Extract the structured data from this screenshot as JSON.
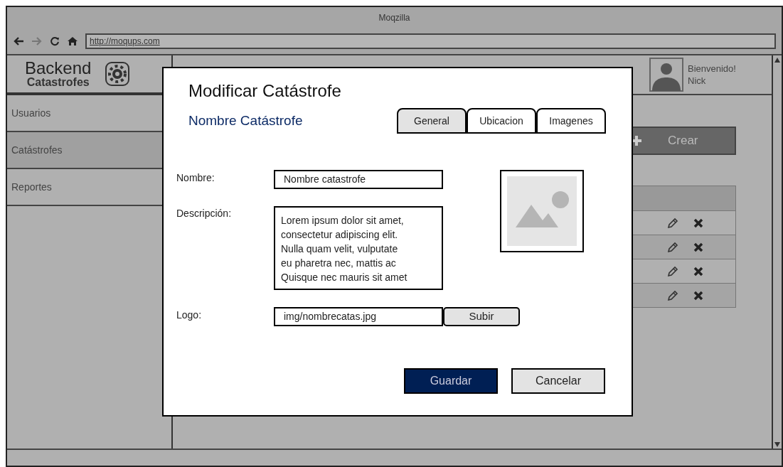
{
  "browser": {
    "title": "Moqzilla",
    "url": "http://moqups.com"
  },
  "sidebar": {
    "brand": "Backend",
    "brand_sub": "Catastrofes",
    "items": [
      {
        "label": "Usuarios",
        "selected": false
      },
      {
        "label": "Catástrofes",
        "selected": true
      },
      {
        "label": "Reportes",
        "selected": false
      }
    ]
  },
  "user": {
    "greeting": "Bienvenido!",
    "name": "Nick"
  },
  "create_button": "Crear",
  "dialog": {
    "title": "Modificar Catástrofe",
    "subtitle": "Nombre Catástrofe",
    "tabs": [
      {
        "label": "General",
        "selected": true
      },
      {
        "label": "Ubicacion",
        "selected": false
      },
      {
        "label": "Imagenes",
        "selected": false
      }
    ],
    "fields": [
      {
        "label": "Nombre:",
        "kind": "input",
        "value": "Nombre catastrofe"
      },
      {
        "label": "Descripción:",
        "kind": "textarea",
        "value": "Lorem ipsum dolor sit amet,\nconsectetur adipiscing elit.\nNulla quam velit, vulputate\neu pharetra nec, mattis ac\nQuisque nec mauris sit amet"
      },
      {
        "label": "Logo:",
        "kind": "file",
        "value": "img/nombrecatas.jpg",
        "button": "Subir"
      }
    ],
    "buttons": [
      {
        "label": "Guardar",
        "kind": "primary"
      },
      {
        "label": "Cancelar",
        "kind": "secondary"
      }
    ]
  }
}
